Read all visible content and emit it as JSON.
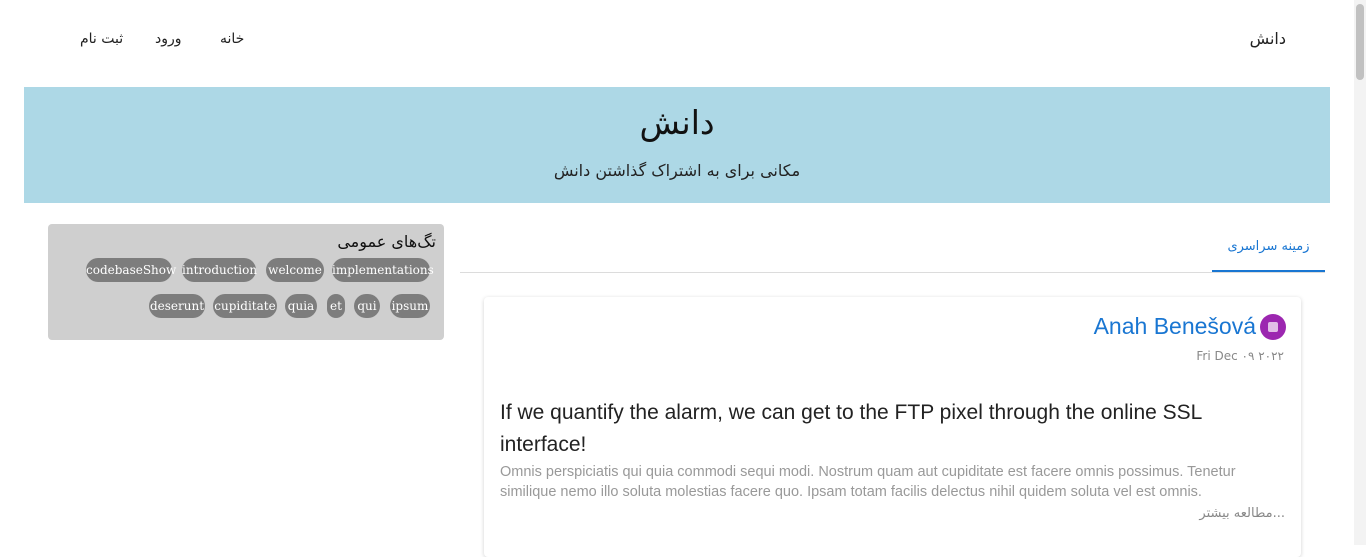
{
  "navbar": {
    "brand": "دانش",
    "links": {
      "home": "خانه",
      "login": "ورود",
      "register": "ثبت نام"
    }
  },
  "hero": {
    "title": "دانش",
    "subtitle": "مکانی برای به اشتراک گذاشتن دانش"
  },
  "tags_panel": {
    "title": "تگ‌های عمومی",
    "tags": [
      "codebaseShow",
      "introduction",
      "welcome",
      "implementations",
      "deserunt",
      "cupiditate",
      "quia",
      "et",
      "qui",
      "ipsum"
    ]
  },
  "tabs": {
    "active": "زمینه سراسری"
  },
  "post": {
    "author": "Anah Benešová",
    "date": "Fri Dec ۰۹ ۲۰۲۲",
    "title": "If we quantify the alarm, we can get to the FTP pixel through the online SSL interface!",
    "excerpt": "Omnis perspiciatis qui quia commodi sequi modi. Nostrum quam aut cupiditate est facere omnis possimus. Tenetur similique nemo illo soluta molestias facere quo. Ipsam totam facilis delectus nihil quidem soluta vel est omnis.",
    "read_more": "مطالعه بیشتر..."
  },
  "colors": {
    "accent": "#1976d2",
    "hero_bg": "#add8e6",
    "tag_bg": "#7d7d7d",
    "panel_bg": "#cfcfcf"
  }
}
